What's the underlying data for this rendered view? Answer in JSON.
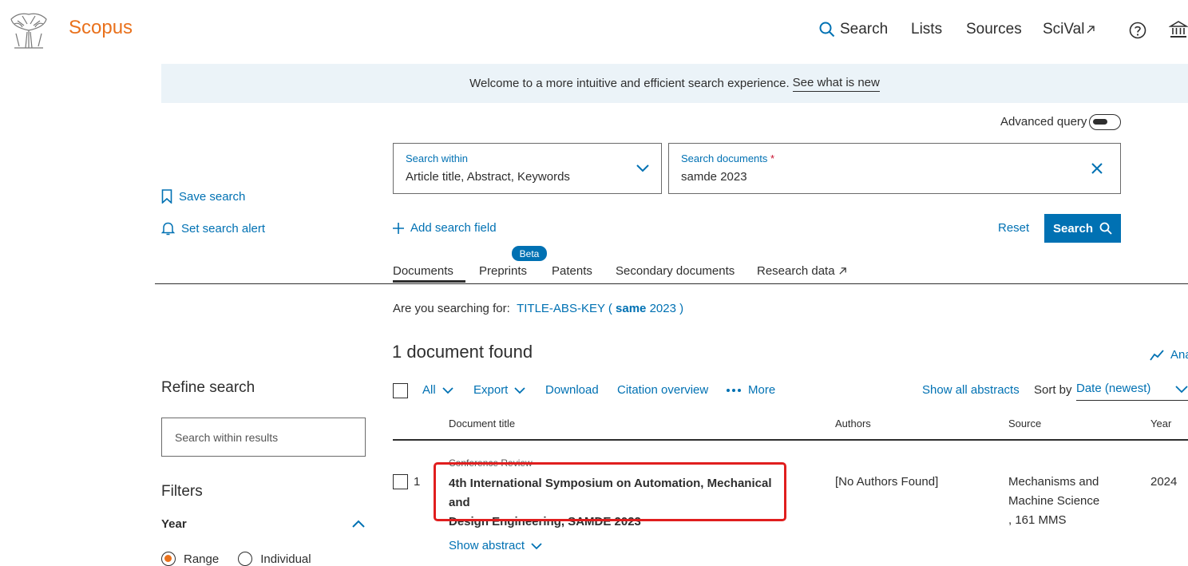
{
  "header": {
    "brand": "Scopus",
    "nav": {
      "search": "Search",
      "lists": "Lists",
      "sources": "Sources",
      "scival": "SciVal"
    }
  },
  "banner": {
    "text": "Welcome to a more intuitive and efficient search experience.",
    "link": "See what is new"
  },
  "search": {
    "advanced_query_label": "Advanced query",
    "within_label": "Search within",
    "within_value": "Article title, Abstract, Keywords",
    "docs_label": "Search documents",
    "docs_required": "*",
    "docs_value": "samde 2023",
    "add_field": "Add search field",
    "reset": "Reset",
    "button": "Search"
  },
  "left_actions": {
    "save_search": "Save search",
    "set_alert": "Set search alert"
  },
  "tabs": {
    "documents": "Documents",
    "preprints": "Preprints",
    "beta": "Beta",
    "patents": "Patents",
    "secondary": "Secondary documents",
    "research_data": "Research data"
  },
  "did_you_mean": {
    "prefix": "Are you searching for:",
    "q_start": "TITLE-ABS-KEY (",
    "q_term": "same",
    "q_end": "2023 )"
  },
  "results": {
    "count_text": "1 document found",
    "analyze": "Ana"
  },
  "refine": {
    "title": "Refine search",
    "within_placeholder": "Search within results",
    "filters": "Filters",
    "year": "Year",
    "range": "Range",
    "individual": "Individual"
  },
  "toolbar": {
    "all": "All",
    "export": "Export",
    "download": "Download",
    "citation_overview": "Citation overview",
    "more": "More",
    "show_all_abstracts": "Show all abstracts",
    "sort_by": "Sort by",
    "sort_value": "Date (newest)"
  },
  "table": {
    "headers": {
      "title": "Document title",
      "authors": "Authors",
      "source": "Source",
      "year": "Year"
    },
    "rows": [
      {
        "index": "1",
        "type": "Conference Review",
        "title_line1": "4th International Symposium on Automation, Mechanical and",
        "title_line2": "Design Engineering, SAMDE 2023",
        "authors": "[No Authors Found]",
        "source_line1": "Mechanisms and",
        "source_line2": "Machine Science",
        "source_line3": ", 161 MMS",
        "year": "2024",
        "show_abstract": "Show abstract"
      }
    ]
  },
  "colors": {
    "brand": "#e9711c",
    "link": "#0071b3",
    "highlight": "#e01e1e"
  }
}
